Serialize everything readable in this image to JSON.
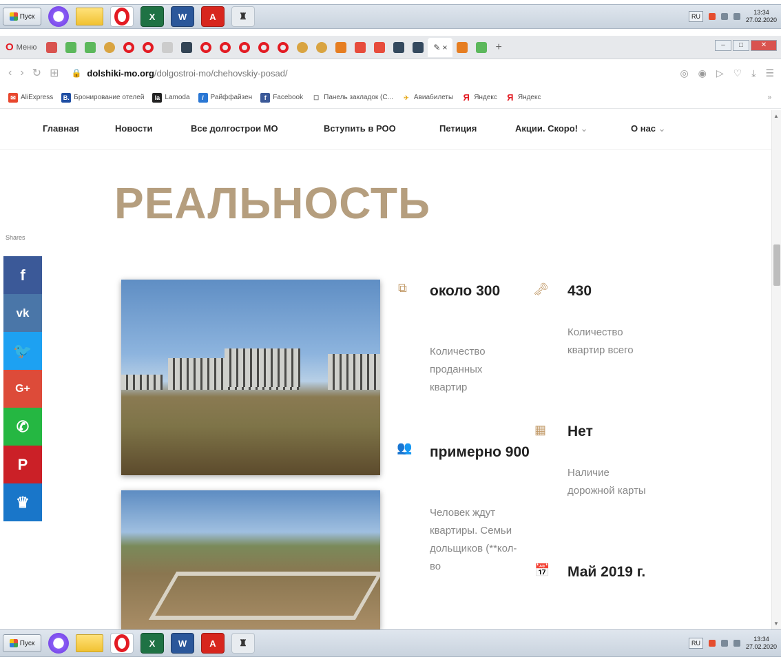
{
  "taskbar": {
    "start_label": "Пуск",
    "lang": "RU",
    "time": "13:34",
    "date": "27.02.2020"
  },
  "browser": {
    "menu_label": "Меню",
    "url_domain": "dolshiki-mo.org",
    "url_path": "/dolgostroi-mo/chehovskiy-posad/"
  },
  "bookmarks": [
    {
      "label": "AliExpress",
      "color": "#e8472e",
      "glyph": "✉"
    },
    {
      "label": "Бронирование отелей",
      "color": "#1f4ea3",
      "glyph": "B."
    },
    {
      "label": "Lamoda",
      "color": "#222222",
      "glyph": "la"
    },
    {
      "label": "Райффайзен",
      "color": "#2a77d4",
      "glyph": "/"
    },
    {
      "label": "Facebook",
      "color": "#3b5998",
      "glyph": "f"
    },
    {
      "label": "Панель закладок (С...",
      "color": "#ffffff",
      "glyph": "☐"
    },
    {
      "label": "Авиабилеты",
      "color": "#ffffff",
      "glyph": "✈"
    },
    {
      "label": "Яндекс",
      "color": "#ffffff",
      "glyph": "Я"
    },
    {
      "label": "Яндекс",
      "color": "#ffffff",
      "glyph": "Я"
    }
  ],
  "nav": {
    "home": "Главная",
    "news": "Новости",
    "all": "Все долгострои МО",
    "join": "Вступить в РОО",
    "petition": "Петиция",
    "actions": "Акции. Скоро!",
    "about": "О нас"
  },
  "page": {
    "title": "РЕАЛЬНОСТЬ",
    "shares_label": "Shares"
  },
  "stats": {
    "sold_value": "около 300",
    "sold_desc": "Количество проданных квартир",
    "total_value": "430",
    "total_desc": "Количество квартир всего",
    "people_value": "примерно 900",
    "people_desc": "Человек ждут квартиры. Семьи дольщиков (**кол-во",
    "roadmap_value": "Нет",
    "roadmap_desc": "Наличие дорожной карты",
    "date_value": "Май 2019 г."
  },
  "colors": {
    "accent": "#b59e7e",
    "icon": "#c29b6a",
    "facebook": "#3b5998",
    "vk": "#4a76a8",
    "twitter": "#1da1f2",
    "gplus": "#dd4b39",
    "whatsapp": "#25b742",
    "pinterest": "#cb2027",
    "crown": "#1976c9"
  }
}
